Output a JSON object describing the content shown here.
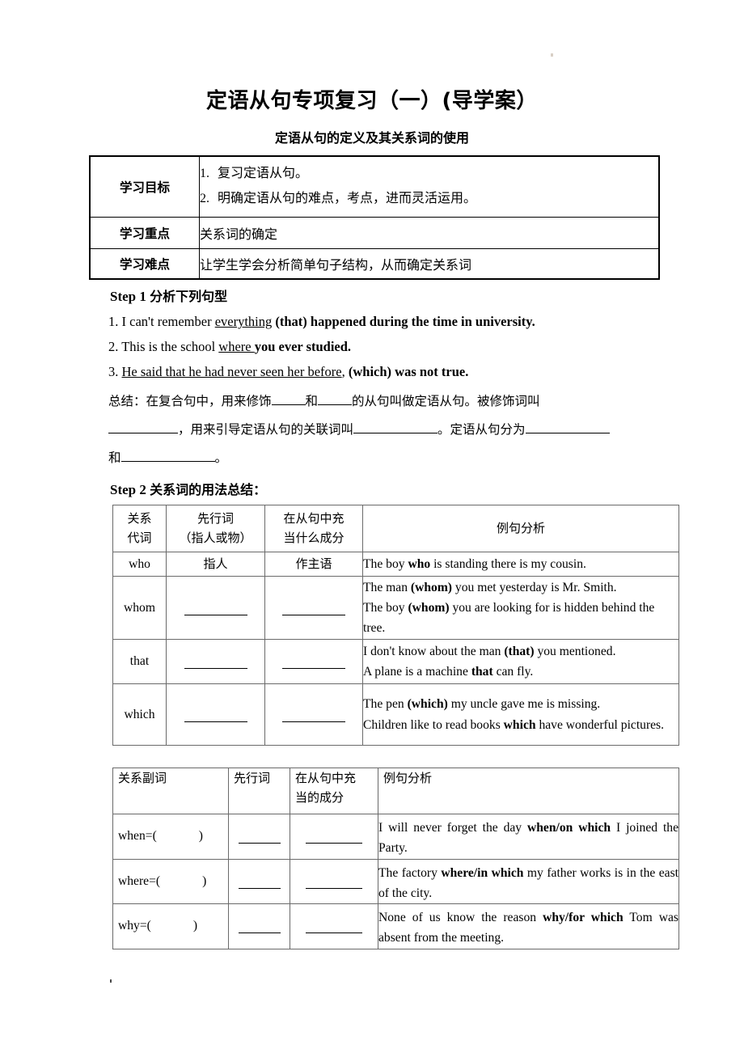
{
  "document": {
    "title": "定语从句专项复习（一）(导学案）",
    "subtitle": "定语从句的定义及其关系词的使用"
  },
  "objectives_table": {
    "rows": [
      {
        "label": "学习目标",
        "items": [
          {
            "num": "1.",
            "text": "复习定语从句。"
          },
          {
            "num": "2.",
            "text": "明确定语从句的难点，考点，进而灵活运用。"
          }
        ]
      },
      {
        "label": "学习重点",
        "text": "关系词的确定"
      },
      {
        "label": "学习难点",
        "text": "让学生学会分析简单句子结构，从而确定关系词"
      }
    ]
  },
  "step1": {
    "heading_en": "Step 1",
    "heading_cn": "分析下列句型",
    "sentences": [
      {
        "num": "1.",
        "plain_a": "I can't remember ",
        "underlined": "everything",
        "bold": " (that) happened during the time in university."
      },
      {
        "num": "2.",
        "plain_a": "This is the school ",
        "underlined": " where ",
        "bold": " you ever studied."
      },
      {
        "num": "3.",
        "underlined": "He said that he had never seen her before",
        "plain_a": ", ",
        "bold": "(which) was not true."
      }
    ]
  },
  "summary": {
    "line1_a": "总结：在复合句中，用来修饰",
    "line1_b": "和",
    "line1_c": "的从句叫做定语从句。被修饰词叫",
    "line2_a": "，用来引导定语从句的关联词叫",
    "line2_b": "。定语从句分为",
    "line3_a": "和",
    "line3_b": "。"
  },
  "step2": {
    "heading_en": "Step 2",
    "heading_cn": "关系词的用法总结："
  },
  "pronoun_table": {
    "headers": {
      "col1": "关系\n代词",
      "col1_l1": "关系",
      "col1_l2": "代词",
      "col2_l1": "先行词",
      "col2_l2": "（指人或物）",
      "col3_l1": "在从句中充",
      "col3_l2": "当什么成分",
      "col4": "例句分析"
    },
    "rows": [
      {
        "word": "who",
        "antecedent": "指人",
        "function": "作主语",
        "examples": [
          "The boy who is standing there is my cousin."
        ],
        "bold_terms": [
          "who"
        ]
      },
      {
        "word": "whom",
        "antecedent": "",
        "function": "",
        "examples": [
          "The man (whom) you met yesterday is Mr. Smith.",
          "The boy (whom) you are looking for is hidden behind the tree."
        ],
        "bold_terms": [
          "(whom)"
        ]
      },
      {
        "word": "that",
        "antecedent": "",
        "function": "",
        "examples": [
          "I don't know about the man (that) you mentioned.",
          "A plane is a machine that can fly."
        ],
        "bold_terms": [
          "(that)",
          "that"
        ]
      },
      {
        "word": "which",
        "antecedent": "",
        "function": "",
        "examples": [
          "The pen (which) my uncle gave me is missing.",
          "Children like to read books which have wonderful pictures."
        ],
        "bold_terms": [
          "(which)",
          "which"
        ]
      }
    ]
  },
  "adverb_table": {
    "headers": {
      "col1": "关系副词",
      "col2": "先行词",
      "col3_l1": "在从句中充",
      "col3_l2": "当的成分",
      "col4": "例句分析"
    },
    "rows": [
      {
        "word": "when=(",
        "close": ")",
        "antecedent": "",
        "function": "",
        "example": "I will never forget the day when/on which I joined the Party.",
        "bold_term": "when/on which"
      },
      {
        "word": "where=(",
        "close": ")",
        "antecedent": "",
        "function": "",
        "example": "The factory where/in which my father works is in the east of the city.",
        "bold_term": "where/in which"
      },
      {
        "word": "why=(",
        "close": ")",
        "antecedent": "",
        "function": "",
        "example": "None of us know the reason why/for which Tom was absent from the meeting.",
        "bold_term": "why/for which"
      }
    ]
  }
}
